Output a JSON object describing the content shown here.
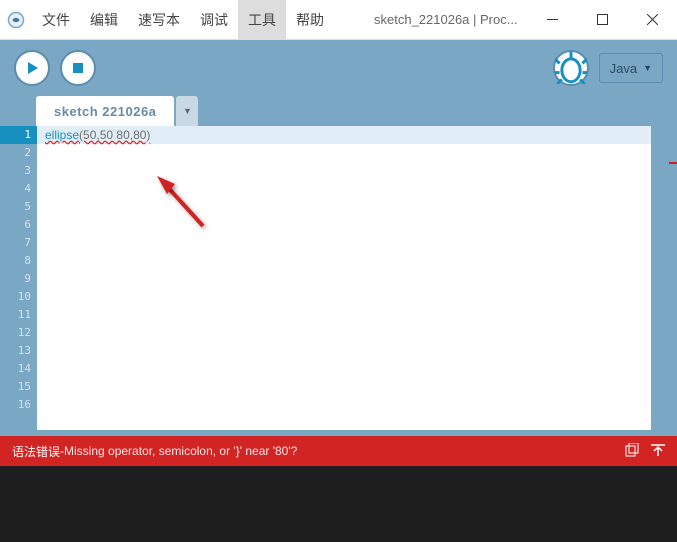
{
  "menubar": {
    "items": [
      {
        "label": "文件"
      },
      {
        "label": "编辑"
      },
      {
        "label": "速写本"
      },
      {
        "label": "调试"
      },
      {
        "label": "工具"
      },
      {
        "label": "帮助"
      }
    ],
    "active_index": 4,
    "title": "sketch_221026a | Proc..."
  },
  "toolbar": {
    "mode_label": "Java"
  },
  "tabs": {
    "active": "sketch 221026a"
  },
  "editor": {
    "line_count": 16,
    "highlighted_line": 1,
    "code_fn": "ellipse",
    "code_args": "(50,50 80,80)"
  },
  "status": {
    "label": "语法错误",
    "sep": " - ",
    "message": "Missing operator, semicolon, or '}' near '80'?"
  }
}
